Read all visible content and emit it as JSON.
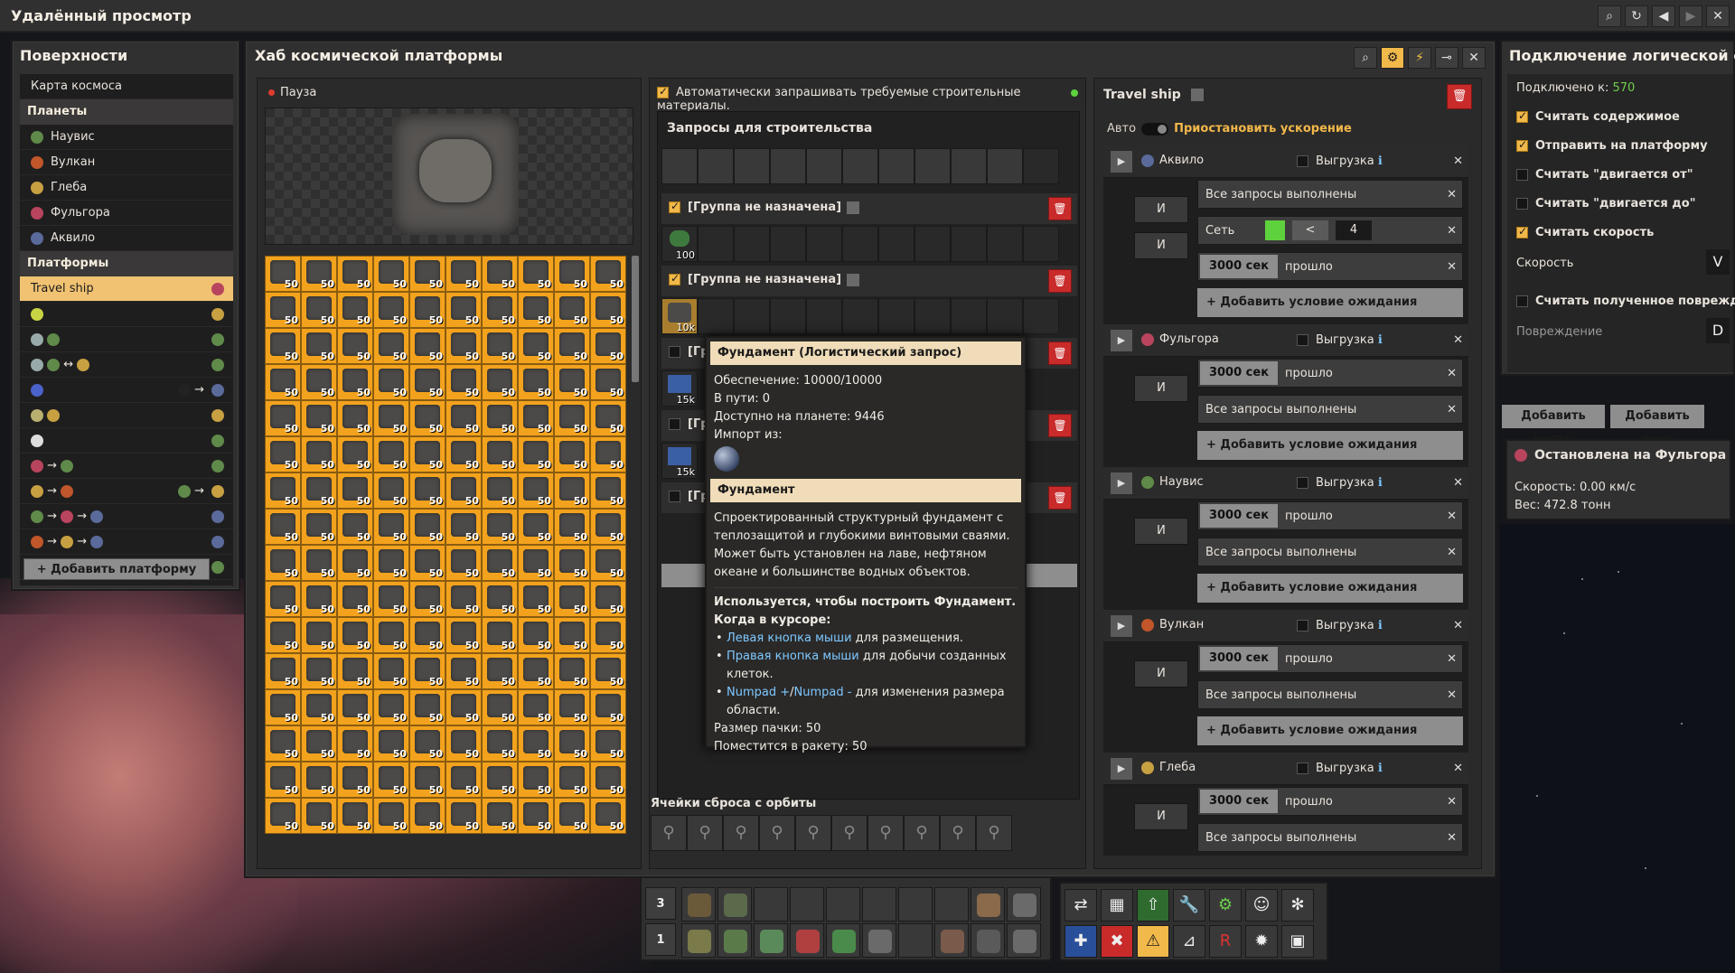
{
  "window": {
    "title": "Удалённый просмотр",
    "buttons": [
      "search-icon",
      "refresh-icon",
      "back-icon",
      "forward-icon",
      "close-icon"
    ]
  },
  "surfaces": {
    "title": "Поверхности",
    "space_map": "Карта космоса",
    "planets_header": "Планеты",
    "planets": [
      {
        "name": "Наувис",
        "color": "#5f8a4a"
      },
      {
        "name": "Вулкан",
        "color": "#c0562a"
      },
      {
        "name": "Глеба",
        "color": "#c7a042"
      },
      {
        "name": "Фульгора",
        "color": "#b8445e"
      },
      {
        "name": "Аквило",
        "color": "#5a6a9a"
      }
    ],
    "platforms_header": "Платформы",
    "selected_platform": "Travel ship",
    "add_platform": "+ Добавить платформу"
  },
  "hub": {
    "title": "Хаб космической платформы",
    "pause_label": "Пауза",
    "inventory_count": "50",
    "inventory_rows": 16,
    "auto_request_label": "Автоматически запрашивать требуемые строительные материалы.",
    "requests_title": "Запросы для строительства",
    "groups": [
      {
        "label": "[Группа не назначена]",
        "checked": true,
        "item_count": "100"
      },
      {
        "label": "[Группа не назначена]",
        "checked": true,
        "item_count": "10k"
      },
      {
        "label": "[Гр",
        "checked": false,
        "item_count": "15k"
      },
      {
        "label": "[Гр",
        "checked": false,
        "item_count": "15k"
      },
      {
        "label": "[Гр",
        "checked": false,
        "item_count": ""
      }
    ],
    "orbit_title": "Ячейки сброса с орбиты"
  },
  "tooltip": {
    "header": "Фундамент (Логистический запрос)",
    "supply": "Обеспечение: 10000/10000",
    "in_transit": "В пути: 0",
    "available": "Доступно на планете: 9446",
    "import_from": "Импорт из:",
    "item_name": "Фундамент",
    "description": "Спроектированный структурный фундамент с теплозащитой и глубокими винтовыми сваями. Может быть установлен на лаве, нефтяном океане и большинстве водных объектов.",
    "used_to": "Используется, чтобы построить Фундамент.",
    "cursor_header": "Когда в курсоре:",
    "lmb": "Левая кнопка мыши",
    "lmb_text": " для размещения.",
    "rmb": "Правая кнопка мыши",
    "rmb_text": " для добычи созданных клеток.",
    "numpad1": "Numpad +",
    "numpad_sep": "/",
    "numpad2": "Numpad -",
    "numpad_text": " для изменения размера области.",
    "stack": "Размер пачки: 50",
    "rocket": "Поместится в ракету: 50"
  },
  "schedule": {
    "title": "Travel ship",
    "auto": "Авто",
    "pause_accel": "Приостановить ускорение",
    "unload": "Выгрузка",
    "and": "И",
    "all_done": "Все запросы выполнены",
    "network": "Сеть",
    "network_value": "4",
    "op": "<",
    "time": "3000 сек",
    "passed": "прошло",
    "add_condition": "+ Добавить условие ожидания",
    "stops": [
      {
        "name": "Аквило",
        "color": "#5a6a9a"
      },
      {
        "name": "Фульгора",
        "color": "#b8445e"
      },
      {
        "name": "Наувис",
        "color": "#5f8a4a"
      },
      {
        "name": "Вулкан",
        "color": "#c0562a"
      },
      {
        "name": "Глеба",
        "color": "#c7a042"
      }
    ]
  },
  "logic": {
    "title": "Подключение логической сети",
    "connected_to": "Подключено к:",
    "connected_value": "570",
    "read_contents": "Считать содержимое",
    "send_to_platform": "Отправить на платформу",
    "read_moving_from": "Считать \"двигается от\"",
    "read_moving_to": "Считать \"двигается до\"",
    "read_speed": "Считать скорость",
    "speed_label": "Скорость",
    "speed_value": "V",
    "read_damage": "Считать полученное повреждение",
    "damage_label": "Повреждение",
    "damage_value": "D",
    "add_tag": "Добавить метку",
    "add_ping": "Добавить пинг",
    "stopped_at": "Остановлена на Фульгора",
    "speed_stat": "Скорость: 0.00 км/с",
    "weight_stat": "Вес: 472.8 тонн"
  },
  "hotbar": {
    "row_top": "3",
    "row_bottom": "1"
  }
}
